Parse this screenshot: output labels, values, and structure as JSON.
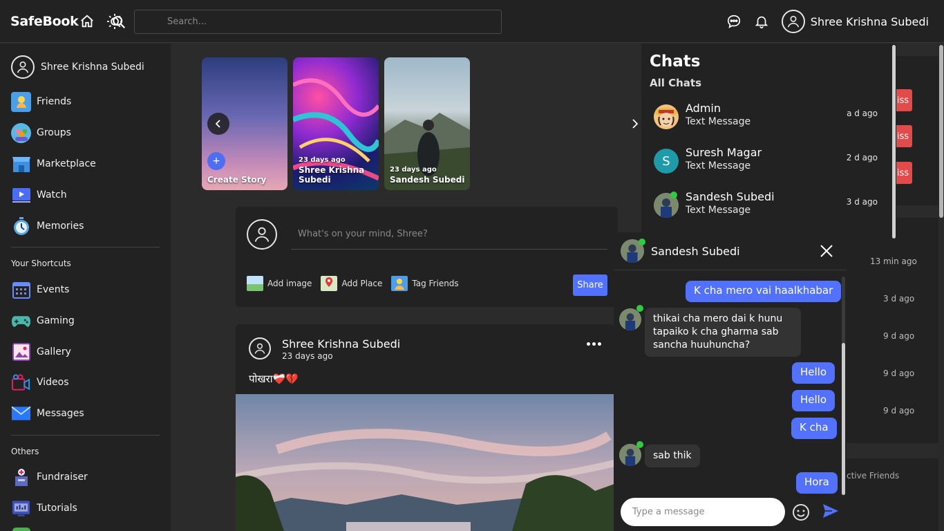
{
  "header": {
    "logo": "SafeBook",
    "search_placeholder": "Search...",
    "user_name": "Shree Krishna Subedi"
  },
  "sidebar": {
    "profile_name": "Shree Krishna Subedi",
    "main_items": [
      {
        "label": "Friends",
        "icon": "friends-icon"
      },
      {
        "label": "Groups",
        "icon": "groups-icon"
      },
      {
        "label": "Marketplace",
        "icon": "marketplace-icon"
      },
      {
        "label": "Watch",
        "icon": "watch-icon"
      },
      {
        "label": "Memories",
        "icon": "memories-icon"
      }
    ],
    "shortcuts_title": "Your Shortcuts",
    "shortcuts": [
      {
        "label": "Events",
        "icon": "events-icon"
      },
      {
        "label": "Gaming",
        "icon": "gaming-icon"
      },
      {
        "label": "Gallery",
        "icon": "gallery-icon"
      },
      {
        "label": "Videos",
        "icon": "videos-icon"
      },
      {
        "label": "Messages",
        "icon": "messages-icon"
      }
    ],
    "others_title": "Others",
    "others": [
      {
        "label": "Fundraiser",
        "icon": "fundraiser-icon"
      },
      {
        "label": "Tutorials",
        "icon": "tutorials-icon"
      }
    ]
  },
  "stories": {
    "create_label": "Create Story",
    "items": [
      {
        "time": "23 days ago",
        "name": "Shree Krishna Subedi"
      },
      {
        "time": "23 days ago",
        "name": "Sandesh Subedi"
      }
    ]
  },
  "composer": {
    "placeholder": "What's on your mind, Shree?",
    "add_image": "Add image",
    "add_place": "Add Place",
    "tag_friends": "Tag Friends",
    "share": "Share"
  },
  "post": {
    "author": "Shree Krishna Subedi",
    "time": "23 days ago",
    "text": "पोखरा❤️‍🩹💔"
  },
  "right_panel": {
    "request_button_text": "iss",
    "times": [
      "13 min ago",
      "3 d ago",
      "9 d ago",
      "9 d ago",
      "9 d ago"
    ],
    "active_friends_partial": "ctive Friends"
  },
  "chats": {
    "title": "Chats",
    "subtitle": "All Chats",
    "list": [
      {
        "name": "Admin",
        "message": "Text Message",
        "time": "a d ago"
      },
      {
        "name": "Suresh Magar",
        "message": "Text Message",
        "time": "2 d ago",
        "initial": "S"
      },
      {
        "name": "Sandesh Subedi",
        "message": "Text Message",
        "time": "3 d ago"
      }
    ]
  },
  "conversation": {
    "name": "Sandesh Subedi",
    "messages": [
      {
        "from": "me",
        "text": "K cha mero vai haalkhabar"
      },
      {
        "from": "them",
        "text": "thikai cha mero dai k hunu tapaiko k cha gharma sab sancha huuhuncha?"
      },
      {
        "from": "me",
        "text": "Hello"
      },
      {
        "from": "me",
        "text": "Hello"
      },
      {
        "from": "me",
        "text": "K cha"
      },
      {
        "from": "them",
        "text": "sab thik"
      },
      {
        "from": "me",
        "text": "Hora"
      }
    ],
    "input_placeholder": "Type a message"
  },
  "colors": {
    "accent": "#5271ff",
    "danger": "#e34b4b",
    "online": "#2ecc40",
    "surface": "#222222",
    "background": "#2b2b2b"
  }
}
